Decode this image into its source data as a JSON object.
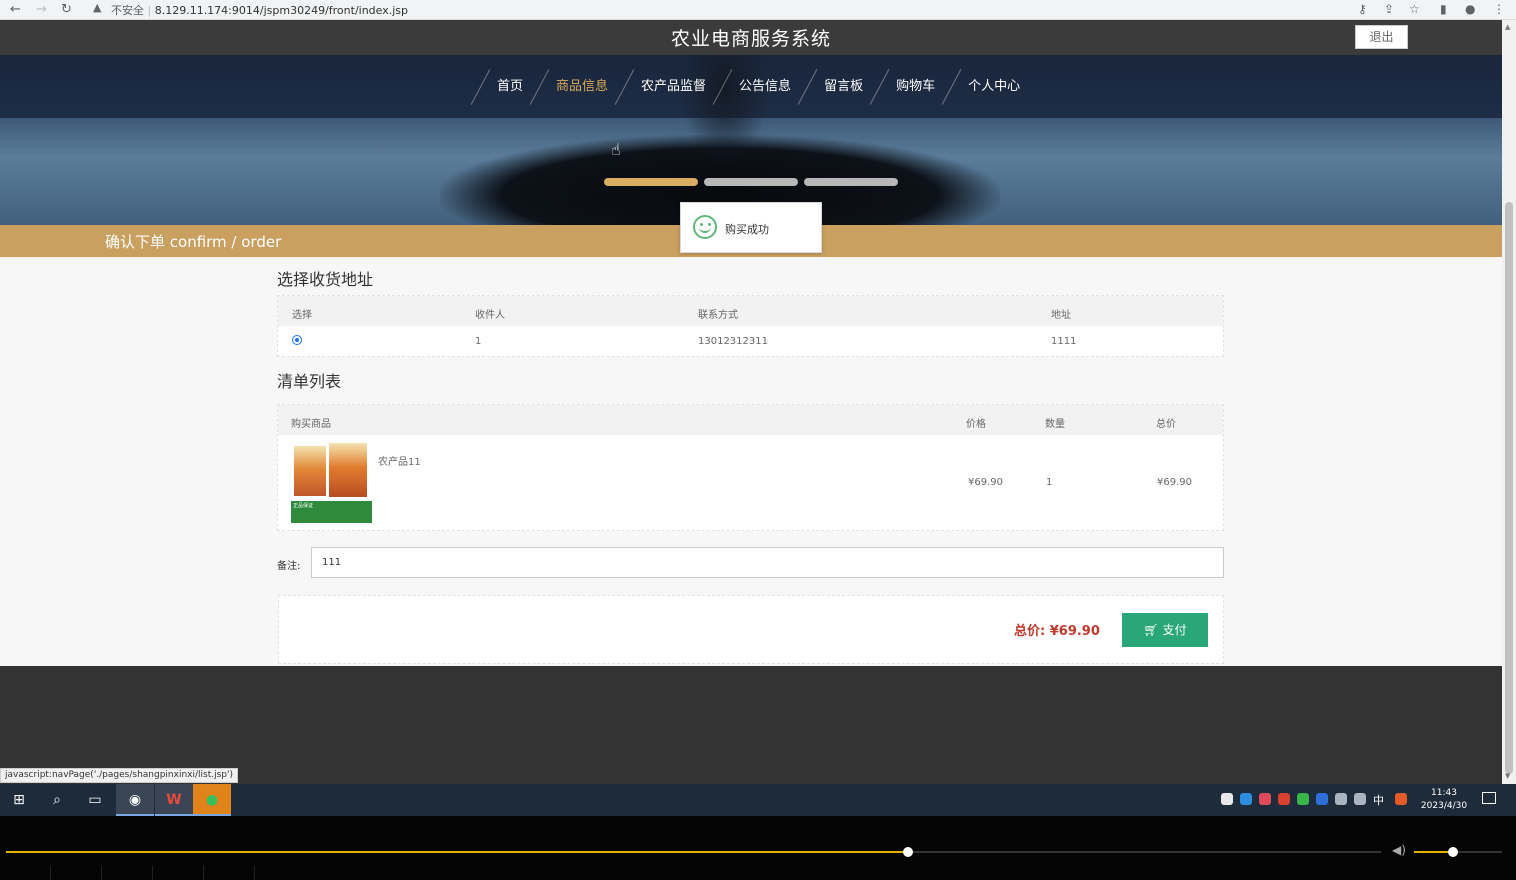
{
  "browser": {
    "security": "不安全",
    "url": "8.129.11.174:9014/jspm30249/front/index.jsp"
  },
  "header": {
    "site_title": "农业电商服务系统",
    "logout": "退出"
  },
  "nav": {
    "items": [
      "首页",
      "商品信息",
      "农产品监督",
      "公告信息",
      "留言板",
      "购物车",
      "个人中心"
    ],
    "active": "商品信息"
  },
  "breadcrumb": "确认下单  confirm / order",
  "toast": "购买成功",
  "address_section": {
    "title": "选择收货地址",
    "headers": [
      "选择",
      "收件人",
      "联系方式",
      "地址"
    ],
    "rows": [
      {
        "selected": true,
        "recipient": "1",
        "phone": "13012312311",
        "address": "1111"
      }
    ]
  },
  "order_section": {
    "title": "清单列表",
    "headers": [
      "购买商品",
      "价格",
      "数量",
      "总价"
    ],
    "items": [
      {
        "name": "农产品11",
        "price": "¥69.90",
        "quantity": "1",
        "total": "¥69.90",
        "image_text": "正品保证"
      }
    ]
  },
  "remark": {
    "label": "备注:",
    "value": "111"
  },
  "summary": {
    "total": "总价:  ¥69.90",
    "pay_button": "支付"
  },
  "statusbar": "javascript:navPage('./pages/shangpinxinxi/list.jsp')",
  "taskbar": {
    "ime": "中",
    "time": "11:43",
    "date": "2023/4/30"
  },
  "colors": {
    "accent": "#c9a060",
    "pay": "#2aa77a",
    "total": "#c0392b",
    "success": "#5fb878"
  },
  "player": {
    "progress": 0.656,
    "volume": 0.44
  }
}
